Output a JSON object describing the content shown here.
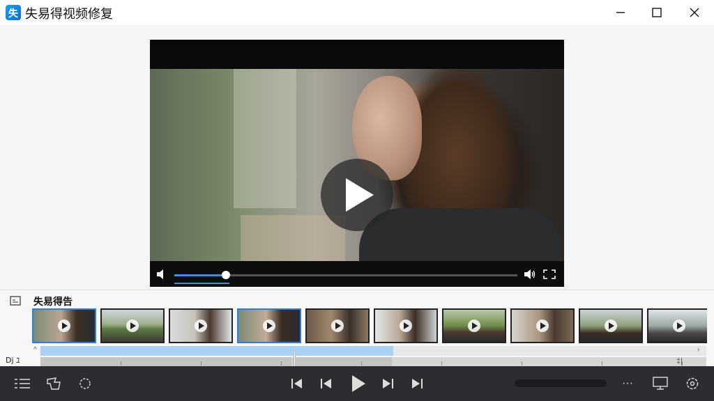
{
  "window": {
    "title": "失易得视频修复",
    "logo_char": "失"
  },
  "player": {
    "progress_fraction": 0.14,
    "knob_fraction": 0.15,
    "buffer_fraction": 0.16,
    "accent": "#3b8fe0"
  },
  "strip": {
    "label": "失易得告",
    "thumbnails": [
      {
        "name": "thumb-1",
        "selected": true
      },
      {
        "name": "thumb-2",
        "selected": false
      },
      {
        "name": "thumb-3",
        "selected": false
      },
      {
        "name": "thumb-4",
        "selected": true
      },
      {
        "name": "thumb-5",
        "selected": false
      },
      {
        "name": "thumb-6",
        "selected": false
      },
      {
        "name": "thumb-7",
        "selected": false
      },
      {
        "name": "thumb-8",
        "selected": false
      },
      {
        "name": "thumb-9",
        "selected": false
      },
      {
        "name": "thumb-10",
        "selected": false
      }
    ]
  },
  "timeline": {
    "side_label": "Dj ﾕ",
    "up_glyph": "^",
    "right_glyph": "›",
    "end_mark": "‡|",
    "fill_fraction": 0.53,
    "cursor_fraction": 0.38
  },
  "bottom_bar": {
    "icons": [
      "menu-icon",
      "lasso-icon",
      "gear-outline-icon",
      "skip-start-icon",
      "previous-icon",
      "play-icon",
      "next-icon",
      "skip-end-icon",
      "more-icon",
      "monitor-icon",
      "settings-icon"
    ],
    "more_label": "···"
  }
}
